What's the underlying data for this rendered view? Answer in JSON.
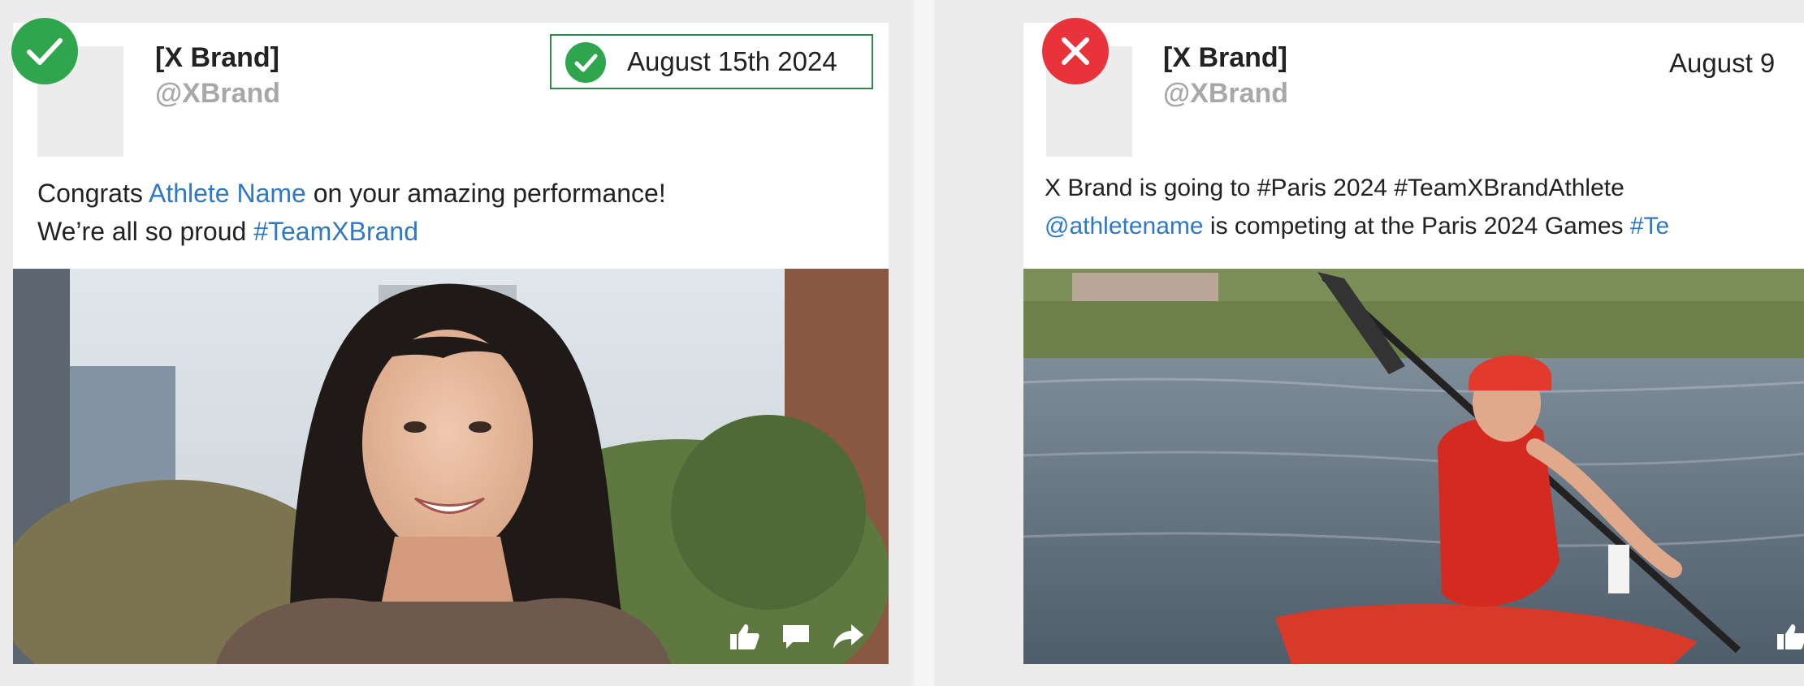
{
  "posts": [
    {
      "status": "approved",
      "status_icon": "check-icon",
      "status_color": "#2fa64e",
      "brand": "[X Brand]",
      "handle": "@XBrand",
      "date": "August 15th 2024",
      "date_highlighted": true,
      "date_check_icon": "check-icon",
      "text_line1": {
        "before": "Congrats ",
        "link": "Athlete Name",
        "after": " on your amazing performance!"
      },
      "text_line2": {
        "before": "We’re all so proud ",
        "link": "#TeamXBrand"
      },
      "image": "woman-portrait-photo",
      "actions": [
        "like-icon",
        "comment-icon",
        "share-icon"
      ]
    },
    {
      "status": "rejected",
      "status_icon": "x-icon",
      "status_color": "#e8333a",
      "brand": "[X Brand]",
      "handle": "@XBrand",
      "date": "August 9",
      "text_line1": {
        "before": "X Brand is going to #Paris 2024 #TeamXBrandAthlete"
      },
      "text_line2": {
        "link": "@athletename",
        "after": " is competing at the Paris 2024 Games ",
        "link2": "#Te"
      },
      "image": "kayaker-photo",
      "actions": [
        "like-icon"
      ]
    }
  ],
  "colors": {
    "link": "#2f79c4",
    "background": "#ececec",
    "card": "#ffffff",
    "approve": "#2fa64e",
    "reject": "#e8333a"
  }
}
